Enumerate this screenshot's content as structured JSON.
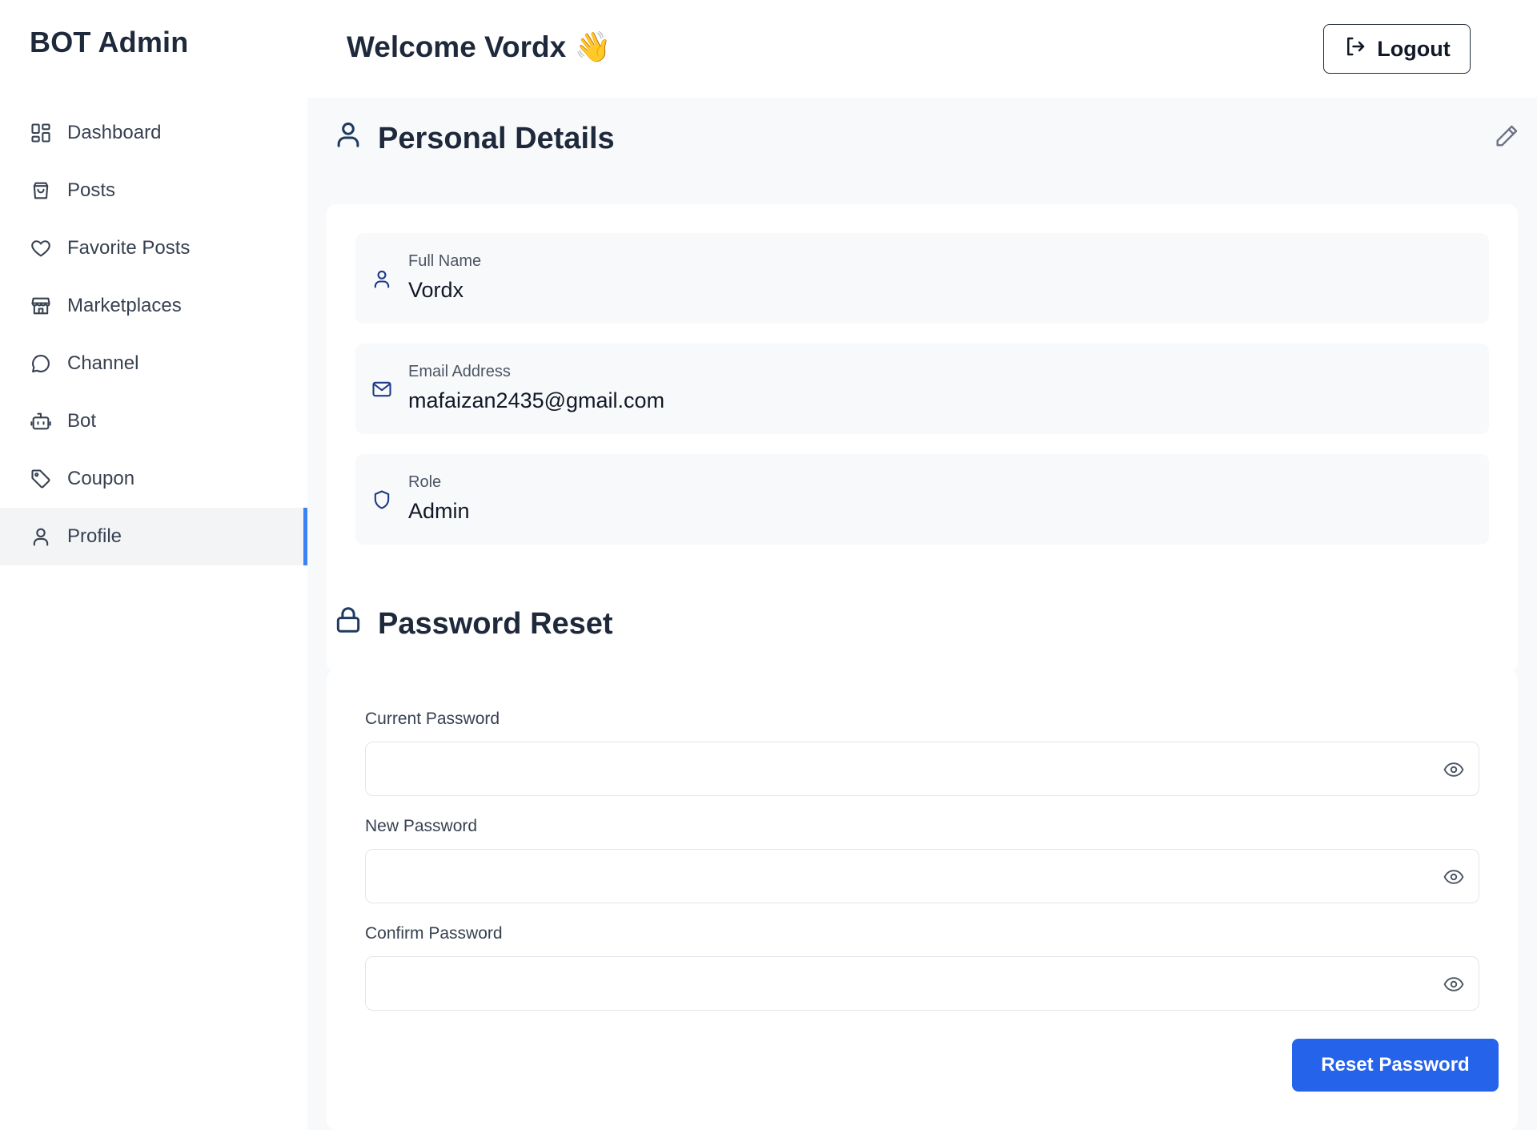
{
  "app": {
    "brand": "BOT Admin"
  },
  "sidebar": {
    "items": [
      {
        "label": "Dashboard",
        "icon": "dashboard-grid-icon",
        "active": false
      },
      {
        "label": "Posts",
        "icon": "shopping-bag-icon",
        "active": false
      },
      {
        "label": "Favorite Posts",
        "icon": "heart-icon",
        "active": false
      },
      {
        "label": "Marketplaces",
        "icon": "store-icon",
        "active": false
      },
      {
        "label": "Channel",
        "icon": "chat-bubble-icon",
        "active": false
      },
      {
        "label": "Bot",
        "icon": "bot-icon",
        "active": false
      },
      {
        "label": "Coupon",
        "icon": "tag-icon",
        "active": false
      },
      {
        "label": "Profile",
        "icon": "user-icon",
        "active": true
      }
    ]
  },
  "header": {
    "welcome": "Welcome Vordx 👋",
    "logout_label": "Logout"
  },
  "personal": {
    "title": "Personal Details",
    "fields": [
      {
        "label": "Full Name",
        "value": "Vordx",
        "icon": "user-icon"
      },
      {
        "label": "Email Address",
        "value": "mafaizan2435@gmail.com",
        "icon": "mail-icon"
      },
      {
        "label": "Role",
        "value": "Admin",
        "icon": "shield-icon"
      }
    ]
  },
  "password": {
    "title": "Password Reset",
    "current_label": "Current Password",
    "new_label": "New Password",
    "confirm_label": "Confirm Password",
    "current_value": "",
    "new_value": "",
    "confirm_value": "",
    "submit_label": "Reset Password"
  },
  "colors": {
    "accent": "#2563eb",
    "active_indicator": "#3b82f6",
    "heading": "#1e293b",
    "panel_bg": "#f8f9fb"
  }
}
